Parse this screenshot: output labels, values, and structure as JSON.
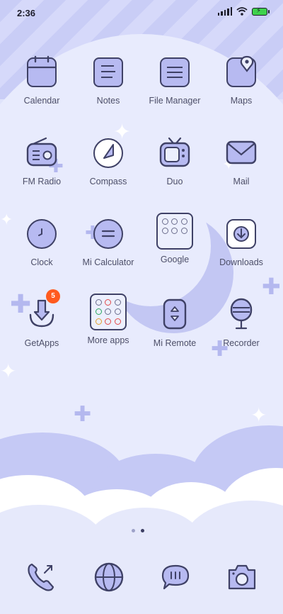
{
  "status_bar": {
    "time": "2:36",
    "battery_state": "charging"
  },
  "apps": [
    {
      "label": "Calendar",
      "icon": "calendar-icon"
    },
    {
      "label": "Notes",
      "icon": "notes-icon"
    },
    {
      "label": "File Manager",
      "icon": "file-manager-icon"
    },
    {
      "label": "Maps",
      "icon": "maps-icon"
    },
    {
      "label": "FM Radio",
      "icon": "radio-icon"
    },
    {
      "label": "Compass",
      "icon": "compass-icon"
    },
    {
      "label": "Duo",
      "icon": "tv-icon"
    },
    {
      "label": "Mail",
      "icon": "mail-icon"
    },
    {
      "label": "Clock",
      "icon": "clock-icon"
    },
    {
      "label": "Mi Calculator",
      "icon": "calculator-icon"
    },
    {
      "label": "Google",
      "icon": "folder-icon"
    },
    {
      "label": "Downloads",
      "icon": "downloads-icon"
    },
    {
      "label": "GetApps",
      "icon": "getapps-icon",
      "badge": "5"
    },
    {
      "label": "More apps",
      "icon": "folder-icon"
    },
    {
      "label": "Mi Remote",
      "icon": "remote-icon"
    },
    {
      "label": "Recorder",
      "icon": "recorder-icon"
    }
  ],
  "page_indicator": {
    "pages": 2,
    "current": 2
  },
  "dock": [
    {
      "icon": "phone-icon"
    },
    {
      "icon": "browser-icon"
    },
    {
      "icon": "messaging-icon"
    },
    {
      "icon": "camera-icon"
    }
  ],
  "colors": {
    "background": "#dfe3fb",
    "icon_fill": "#b7baf1",
    "icon_stroke": "#3f4166",
    "badge": "#ff5a1f",
    "battery": "#3fd24c"
  }
}
